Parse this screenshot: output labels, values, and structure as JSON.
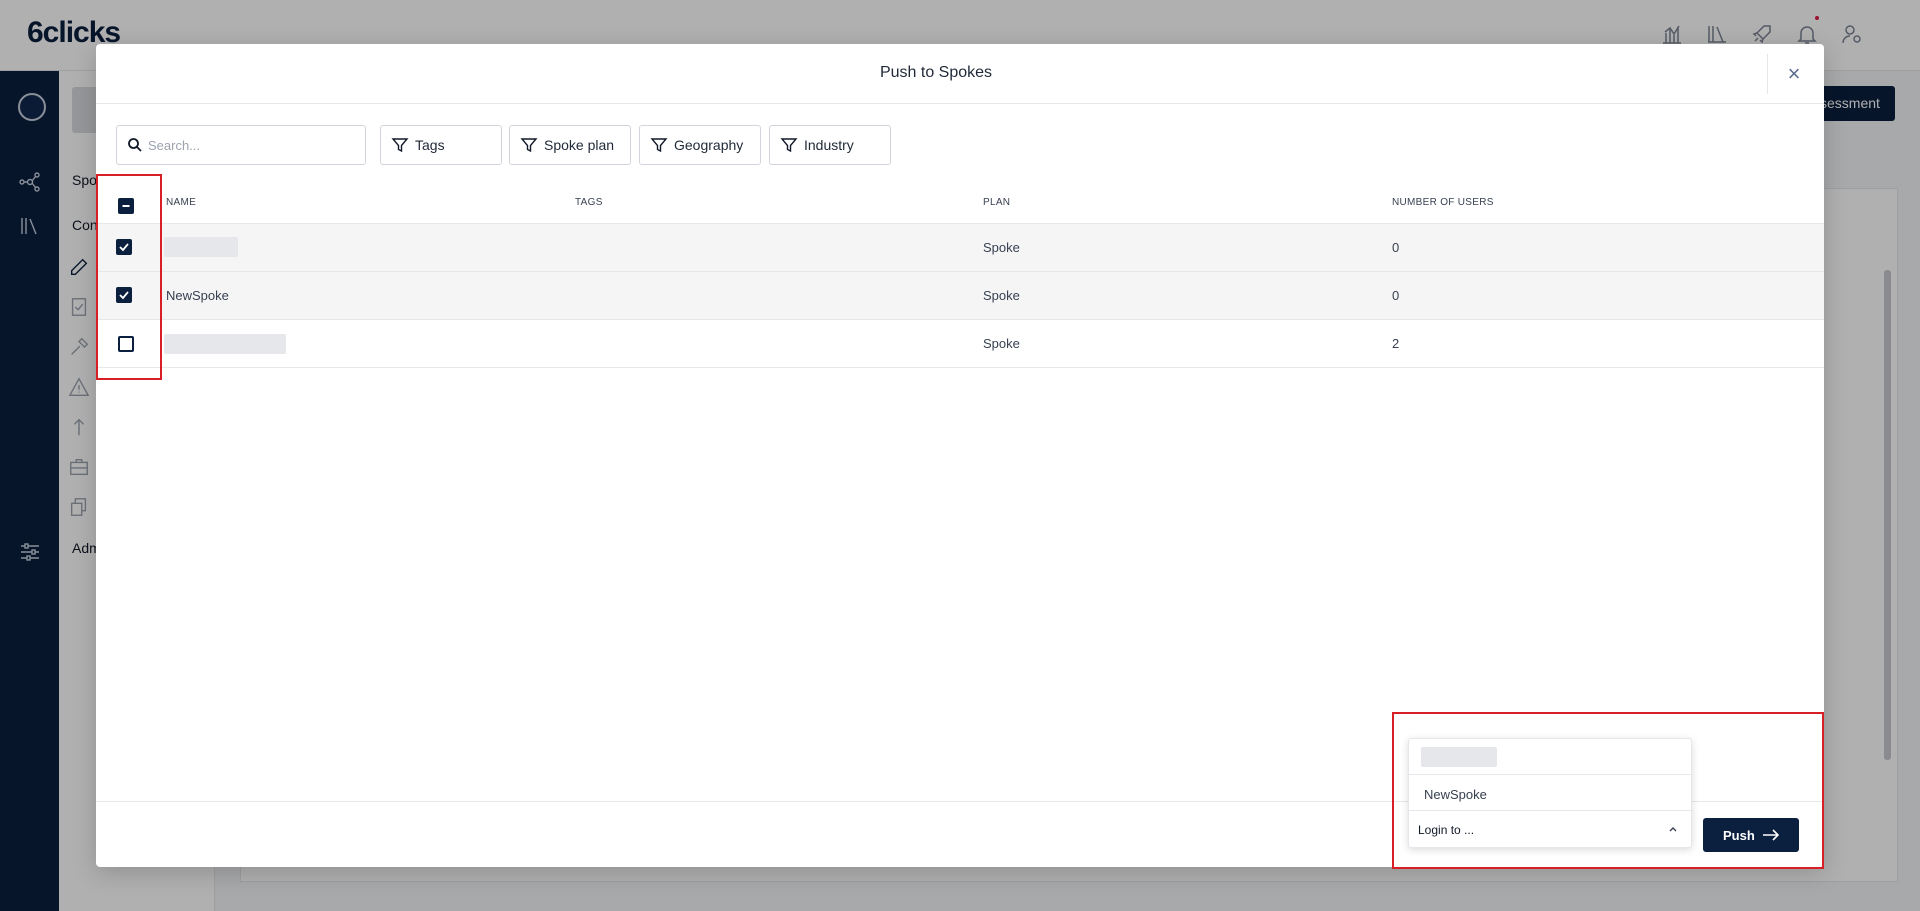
{
  "app": {
    "brand": "6clicks",
    "top_icons": [
      "analytics-icon",
      "library-icon",
      "rocket-icon",
      "bell-icon",
      "user-settings-icon"
    ],
    "sidebar_icons": [
      "hub-network-icon",
      "library-icon",
      "sliders-icon"
    ],
    "subnav_items": [
      "Spo",
      "Con",
      "Adm"
    ],
    "subnav_icons": [
      "edit-icon",
      "checklist-icon",
      "hammer-icon",
      "warning-icon",
      "upload-icon",
      "briefcase-icon",
      "documents-icon"
    ],
    "bg_button_label": "ssessment"
  },
  "modal": {
    "title": "Push to Spokes",
    "close_symbol": "×",
    "search": {
      "placeholder": "Search...",
      "value": ""
    },
    "filters": [
      {
        "label": "Tags"
      },
      {
        "label": "Spoke plan"
      },
      {
        "label": "Geography"
      },
      {
        "label": "Industry"
      }
    ],
    "table": {
      "columns": [
        "NAME",
        "TAGS",
        "PLAN",
        "NUMBER OF USERS"
      ],
      "select_all_state": "indeterminate",
      "rows": [
        {
          "name": "",
          "name_redacted": true,
          "tags": "",
          "plan": "Spoke",
          "users": "0",
          "checked": true
        },
        {
          "name": "NewSpoke",
          "name_redacted": false,
          "tags": "",
          "plan": "Spoke",
          "users": "0",
          "checked": true
        },
        {
          "name": "",
          "name_redacted": true,
          "tags": "",
          "plan": "Spoke",
          "users": "2",
          "checked": false
        }
      ]
    },
    "login_select": {
      "label": "Login to ...",
      "options": [
        {
          "label": "",
          "redacted": true
        },
        {
          "label": "NewSpoke",
          "redacted": false
        }
      ]
    },
    "push_label": "Push"
  },
  "colors": {
    "primary": "#0b1f3f",
    "highlight": "#d81f26",
    "notification": "#e11d48"
  }
}
